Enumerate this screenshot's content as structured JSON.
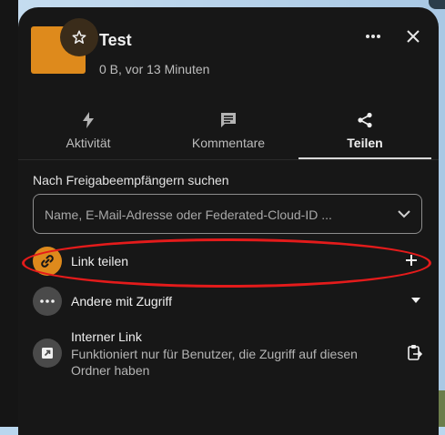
{
  "file": {
    "title": "Test",
    "subtitle": "0 B, vor 13 Minuten"
  },
  "icons": {
    "star": "star-icon",
    "more": "more-horizontal-icon",
    "close": "close-icon"
  },
  "tabs": [
    {
      "label": "Aktivität",
      "icon": "lightning-icon",
      "active": false
    },
    {
      "label": "Kommentare",
      "icon": "comment-icon",
      "active": false
    },
    {
      "label": "Teilen",
      "icon": "share-icon",
      "active": true
    }
  ],
  "search": {
    "label": "Nach Freigabeempfängern suchen",
    "placeholder": "Name, E-Mail-Adresse oder Federated-Cloud-ID ..."
  },
  "share_link": {
    "label": "Link teilen",
    "action": "+"
  },
  "others_with_access": {
    "label": "Andere mit Zugriff"
  },
  "internal_link": {
    "title": "Interner Link",
    "description": "Funktioniert nur für Benutzer, die Zugriff auf diesen Ordner haben"
  },
  "colors": {
    "accent_orange": "#de8a1c",
    "panel_bg": "#171717",
    "highlight_red": "#e41b1b"
  }
}
